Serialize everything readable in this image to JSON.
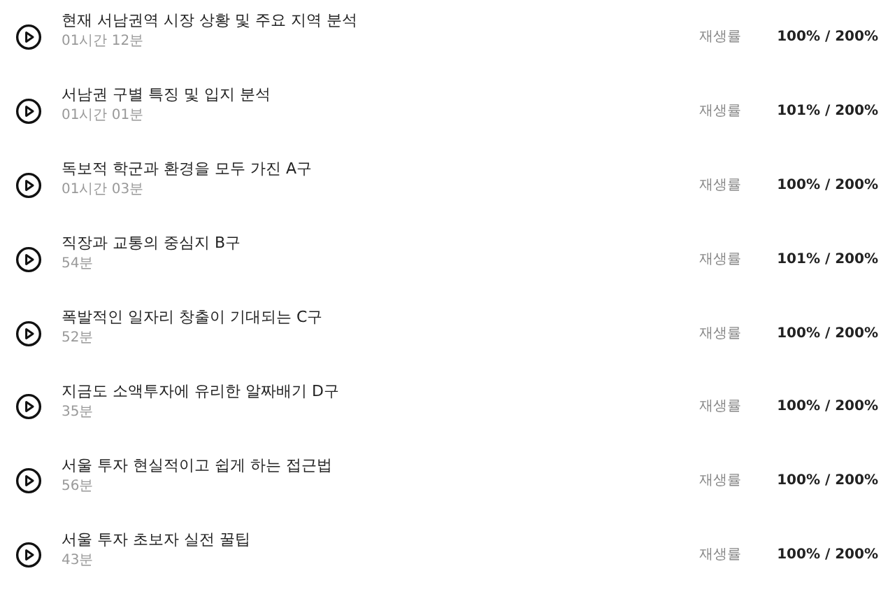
{
  "lessons": [
    {
      "title": "현재 서남권역 시장 상황 및 주요 지역 분석",
      "duration": "01시간 12분",
      "rate_label": "재생률",
      "rate": "100% / 200%"
    },
    {
      "title": "서남권 구별 특징 및 입지 분석",
      "duration": "01시간 01분",
      "rate_label": "재생률",
      "rate": "101% / 200%"
    },
    {
      "title": "독보적 학군과 환경을 모두 가진 A구",
      "duration": "01시간 03분",
      "rate_label": "재생률",
      "rate": "100% / 200%"
    },
    {
      "title": "직장과 교통의 중심지 B구",
      "duration": "54분",
      "rate_label": "재생률",
      "rate": "101% / 200%"
    },
    {
      "title": "폭발적인 일자리 창출이 기대되는 C구",
      "duration": "52분",
      "rate_label": "재생률",
      "rate": "100% / 200%"
    },
    {
      "title": "지금도 소액투자에 유리한 알짜배기 D구",
      "duration": "35분",
      "rate_label": "재생률",
      "rate": "100% / 200%"
    },
    {
      "title": "서울 투자 현실적이고 쉽게 하는 접근법",
      "duration": "56분",
      "rate_label": "재생률",
      "rate": "100% / 200%"
    },
    {
      "title": "서울 투자 초보자 실전 꿀팁",
      "duration": "43분",
      "rate_label": "재생률",
      "rate": "100% / 200%"
    }
  ]
}
